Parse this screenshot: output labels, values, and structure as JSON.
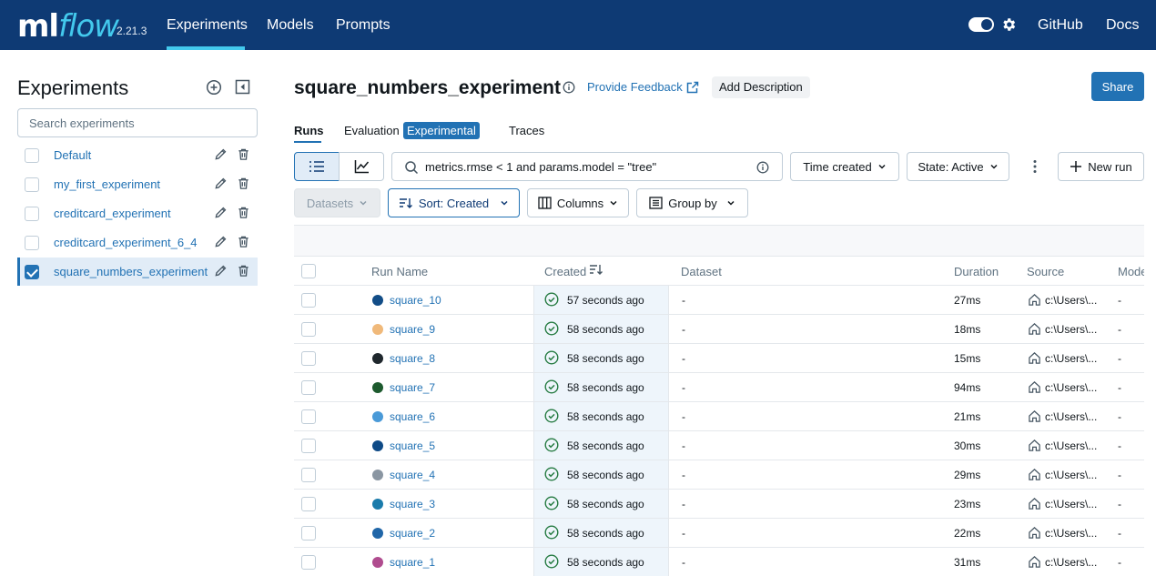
{
  "nav": {
    "logo_ml": "ml",
    "logo_flow": "flow",
    "version": "2.21.3",
    "links": [
      "Experiments",
      "Models",
      "Prompts"
    ],
    "right_links": [
      "GitHub",
      "Docs"
    ]
  },
  "sidebar": {
    "title": "Experiments",
    "search_placeholder": "Search experiments",
    "experiments": [
      {
        "name": "Default",
        "selected": false
      },
      {
        "name": "my_first_experiment",
        "selected": false
      },
      {
        "name": "creditcard_experiment",
        "selected": false
      },
      {
        "name": "creditcard_experiment_6_4",
        "selected": false
      },
      {
        "name": "square_numbers_experiment",
        "selected": true
      }
    ]
  },
  "header": {
    "title": "square_numbers_experiment",
    "feedback": "Provide Feedback",
    "add_description": "Add Description",
    "share": "Share"
  },
  "tabs": {
    "runs": "Runs",
    "evaluation": "Evaluation",
    "experimental_badge": "Experimental",
    "traces": "Traces"
  },
  "toolbar": {
    "filter_value": "metrics.rmse < 1 and params.model = \"tree\"",
    "time_created": "Time created",
    "state": "State: Active",
    "new_run": "New run",
    "datasets": "Datasets",
    "sort": "Sort: Created",
    "columns": "Columns",
    "group_by": "Group by"
  },
  "table": {
    "headers": {
      "run_name": "Run Name",
      "created": "Created",
      "dataset": "Dataset",
      "duration": "Duration",
      "source": "Source",
      "models": "Models"
    },
    "rows": [
      {
        "name": "square_10",
        "color": "#124d87",
        "created": "57 seconds ago",
        "dataset": "-",
        "duration": "27ms",
        "source": "c:\\Users\\...",
        "models": "-"
      },
      {
        "name": "square_9",
        "color": "#f0b97a",
        "created": "58 seconds ago",
        "dataset": "-",
        "duration": "18ms",
        "source": "c:\\Users\\...",
        "models": "-"
      },
      {
        "name": "square_8",
        "color": "#1f272d",
        "created": "58 seconds ago",
        "dataset": "-",
        "duration": "15ms",
        "source": "c:\\Users\\...",
        "models": "-"
      },
      {
        "name": "square_7",
        "color": "#1d5a2e",
        "created": "58 seconds ago",
        "dataset": "-",
        "duration": "94ms",
        "source": "c:\\Users\\...",
        "models": "-"
      },
      {
        "name": "square_6",
        "color": "#4a9ad8",
        "created": "58 seconds ago",
        "dataset": "-",
        "duration": "21ms",
        "source": "c:\\Users\\...",
        "models": "-"
      },
      {
        "name": "square_5",
        "color": "#0e4a86",
        "created": "58 seconds ago",
        "dataset": "-",
        "duration": "30ms",
        "source": "c:\\Users\\...",
        "models": "-"
      },
      {
        "name": "square_4",
        "color": "#8a96a2",
        "created": "58 seconds ago",
        "dataset": "-",
        "duration": "29ms",
        "source": "c:\\Users\\...",
        "models": "-"
      },
      {
        "name": "square_3",
        "color": "#1a7bab",
        "created": "58 seconds ago",
        "dataset": "-",
        "duration": "23ms",
        "source": "c:\\Users\\...",
        "models": "-"
      },
      {
        "name": "square_2",
        "color": "#2066a8",
        "created": "58 seconds ago",
        "dataset": "-",
        "duration": "22ms",
        "source": "c:\\Users\\...",
        "models": "-"
      },
      {
        "name": "square_1",
        "color": "#b04c8f",
        "created": "58 seconds ago",
        "dataset": "-",
        "duration": "31ms",
        "source": "c:\\Users\\...",
        "models": "-"
      }
    ]
  }
}
